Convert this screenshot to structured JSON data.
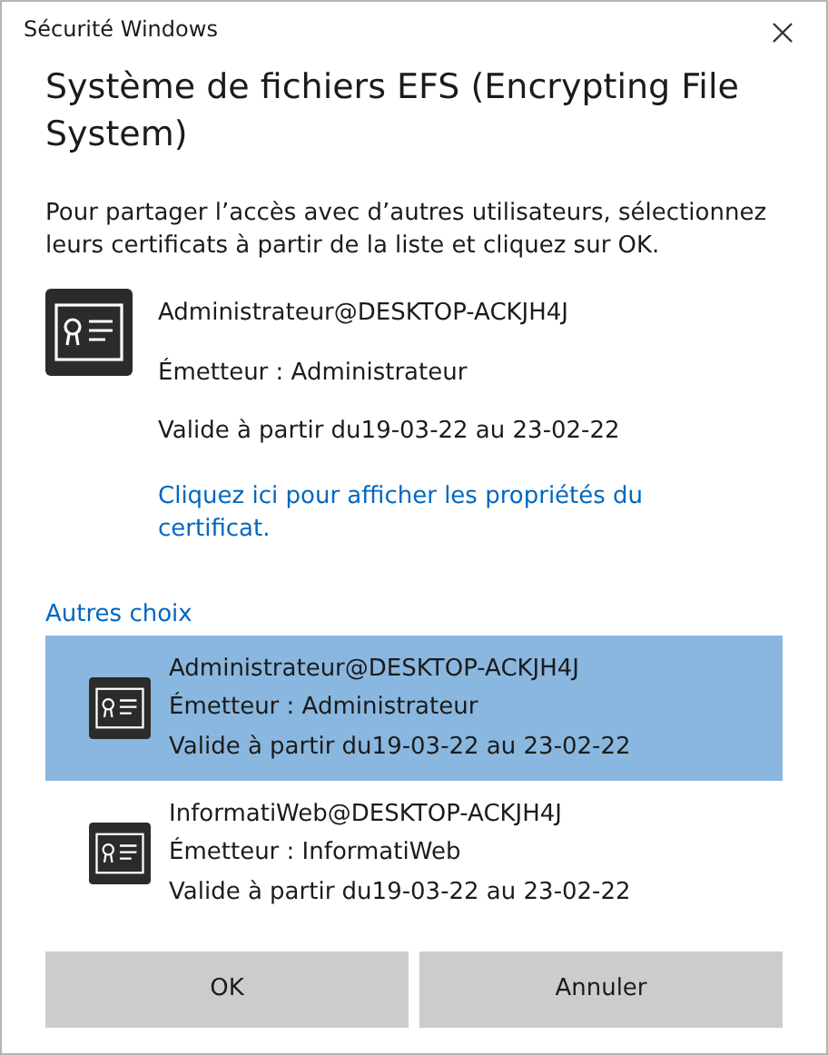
{
  "window": {
    "title": "Sécurité Windows"
  },
  "heading": "Système de fichiers EFS (Encrypting File System)",
  "description": "Pour partager l’accès avec d’autres utilisateurs, sélectionnez leurs certificats à partir de la liste et cliquez sur OK.",
  "certificate": {
    "subject": "Administrateur@DESKTOP-ACKJH4J",
    "issuer": "Émetteur : Administrateur",
    "validity": "Valide à partir du19-03-22 au 23-02-22",
    "link": "Cliquez ici pour afficher les propriétés du certificat."
  },
  "other_choices": {
    "label": "Autres choix",
    "items": [
      {
        "subject": "Administrateur@DESKTOP-ACKJH4J",
        "issuer": "Émetteur : Administrateur",
        "validity": "Valide à partir du19-03-22 au 23-02-22",
        "selected": true
      },
      {
        "subject": "InformatiWeb@DESKTOP-ACKJH4J",
        "issuer": "Émetteur : InformatiWeb",
        "validity": "Valide à partir du19-03-22 au 23-02-22",
        "selected": false
      }
    ]
  },
  "buttons": [
    "OK",
    "Annuler"
  ]
}
